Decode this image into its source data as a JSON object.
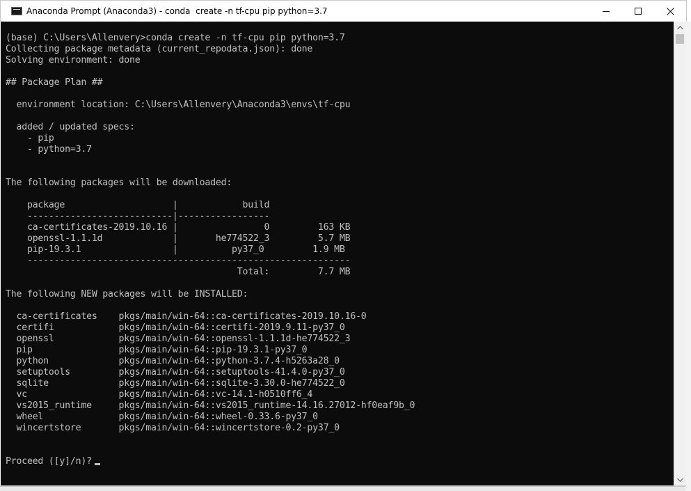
{
  "window": {
    "title": "Anaconda Prompt (Anaconda3) - conda  create -n tf-cpu pip python=3.7",
    "icon": "console-icon",
    "controls": {
      "minimize": "minimize-icon",
      "maximize": "maximize-icon",
      "close": "close-icon"
    }
  },
  "console": {
    "lines": [
      "(base) C:\\Users\\Allenvery>conda create -n tf-cpu pip python=3.7",
      "Collecting package metadata (current_repodata.json): done",
      "Solving environment: done",
      "",
      "## Package Plan ##",
      "",
      "  environment location: C:\\Users\\Allenvery\\Anaconda3\\envs\\tf-cpu",
      "",
      "  added / updated specs:",
      "    - pip",
      "    - python=3.7",
      "",
      "",
      "The following packages will be downloaded:",
      "",
      "    package                    |            build",
      "    ---------------------------|-----------------",
      "    ca-certificates-2019.10.16 |                0         163 KB",
      "    openssl-1.1.1d             |       he774522_3         5.7 MB",
      "    pip-19.3.1                 |          py37_0         1.9 MB",
      "    ------------------------------------------------------------",
      "                                           Total:         7.7 MB",
      "",
      "The following NEW packages will be INSTALLED:",
      "",
      "  ca-certificates    pkgs/main/win-64::ca-certificates-2019.10.16-0",
      "  certifi            pkgs/main/win-64::certifi-2019.9.11-py37_0",
      "  openssl            pkgs/main/win-64::openssl-1.1.1d-he774522_3",
      "  pip                pkgs/main/win-64::pip-19.3.1-py37_0",
      "  python             pkgs/main/win-64::python-3.7.4-h5263a28_0",
      "  setuptools         pkgs/main/win-64::setuptools-41.4.0-py37_0",
      "  sqlite             pkgs/main/win-64::sqlite-3.30.0-he774522_0",
      "  vc                 pkgs/main/win-64::vc-14.1-h0510ff6_4",
      "  vs2015_runtime     pkgs/main/win-64::vs2015_runtime-14.16.27012-hf0eaf9b_0",
      "  wheel              pkgs/main/win-64::wheel-0.33.6-py37_0",
      "  wincertstore       pkgs/main/win-64::wincertstore-0.2-py37_0",
      "",
      ""
    ],
    "prompt": "Proceed ([y]/n)?"
  },
  "colors": {
    "console_bg": "#0c0c0c",
    "console_fg": "#c0c0c0",
    "titlebar_bg": "#ffffff"
  },
  "scrollbar": {
    "up_icon": "scroll-up-icon",
    "down_icon": "scroll-down-icon"
  }
}
